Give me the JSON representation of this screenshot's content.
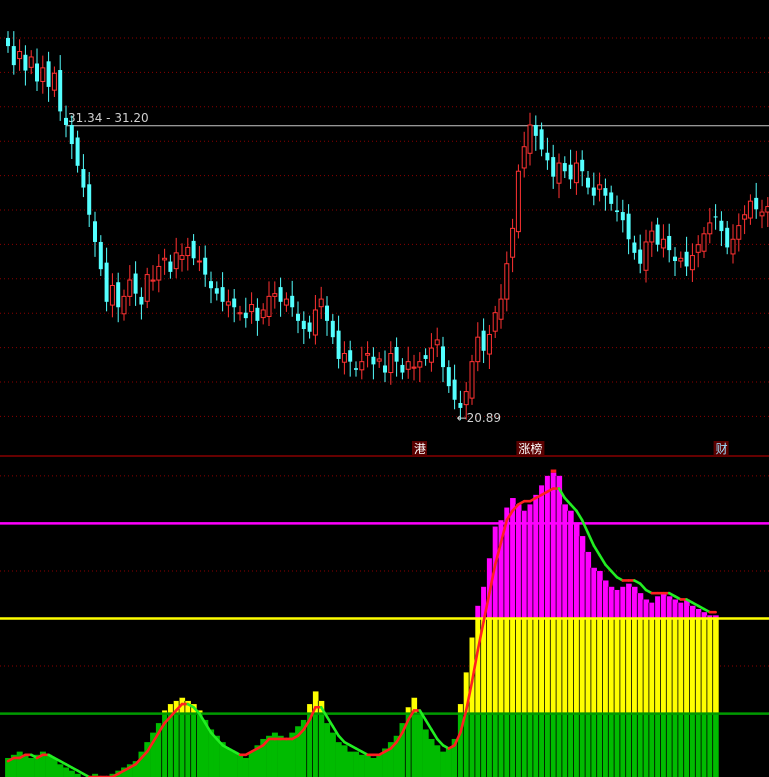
{
  "chart_data": [
    {
      "type": "candlestick",
      "title": "",
      "ylim": [
        19.5,
        35.6
      ],
      "grid": true,
      "reference_line": {
        "label": "31.34 - 31.20",
        "value": 31.27
      },
      "low_marker": {
        "label": "←20.89",
        "index": 77,
        "value": 20.89
      },
      "event_labels": [
        {
          "text": "港",
          "index": 70
        },
        {
          "text": "涨榜",
          "index": 88
        },
        {
          "text": "财",
          "index": 122
        }
      ],
      "colors": {
        "up": "#ff3232",
        "down": "#54ffff",
        "grid": "#8b0000",
        "refline": "#c8c8c8"
      },
      "closes": [
        34.2,
        33.5,
        34.0,
        33.3,
        33.8,
        32.9,
        33.4,
        32.7,
        33.2,
        31.8,
        31.3,
        30.6,
        29.8,
        29.0,
        28.0,
        27.0,
        26.0,
        24.8,
        25.4,
        24.6,
        25.0,
        25.6,
        25.1,
        24.7,
        25.8,
        25.6,
        26.1,
        26.4,
        25.9,
        26.6,
        26.5,
        26.8,
        26.4,
        26.3,
        25.8,
        25.3,
        25.1,
        24.8,
        24.8,
        24.6,
        24.4,
        24.2,
        24.7,
        24.1,
        24.5,
        25.0,
        25.1,
        24.8,
        24.9,
        24.6,
        24.1,
        23.8,
        23.7,
        24.5,
        24.9,
        24.1,
        23.5,
        22.7,
        22.9,
        22.6,
        22.3,
        22.6,
        22.9,
        22.5,
        22.7,
        22.2,
        22.9,
        22.6,
        22.2,
        22.6,
        22.4,
        22.6,
        22.7,
        23.1,
        23.4,
        22.4,
        21.7,
        21.2,
        20.9,
        21.5,
        22.6,
        23.5,
        23.0,
        23.6,
        24.4,
        24.9,
        26.2,
        27.5,
        29.6,
        30.5,
        31.3,
        30.9,
        30.4,
        30.0,
        29.4,
        29.9,
        29.6,
        29.3,
        29.9,
        29.6,
        29.0,
        28.7,
        29.1,
        28.7,
        28.4,
        28.1,
        27.8,
        27.1,
        26.6,
        26.2,
        27.0,
        27.4,
        26.9,
        27.1,
        26.7,
        26.3,
        26.4,
        26.1,
        26.5,
        26.9,
        27.3,
        27.7,
        27.9,
        27.4,
        26.8,
        27.1,
        27.6,
        28.0,
        28.5,
        28.2,
        28.1,
        28.3
      ]
    },
    {
      "type": "bar",
      "title": "",
      "ylim": [
        0,
        100
      ],
      "thresholds": [
        {
          "value": 20,
          "color": "#00bb00"
        },
        {
          "value": 50,
          "color": "#ffff00"
        },
        {
          "value": 80,
          "color": "#ff00ff"
        }
      ],
      "series": [
        {
          "values": [
            6,
            7,
            8,
            7,
            6,
            7,
            8,
            7,
            6,
            4,
            3,
            2,
            1,
            0,
            0,
            1,
            0,
            0,
            1,
            2,
            3,
            4,
            5,
            8,
            11,
            14,
            17,
            21,
            23,
            24,
            25,
            24,
            23,
            21,
            18,
            15,
            13,
            11,
            9,
            8,
            7,
            6,
            8,
            10,
            12,
            13,
            14,
            13,
            12,
            14,
            16,
            18,
            23,
            27,
            24,
            17,
            14,
            11,
            10,
            8,
            8,
            7,
            7,
            6,
            7,
            9,
            11,
            13,
            17,
            22,
            25,
            20,
            15,
            12,
            10,
            8,
            9,
            12,
            23,
            33,
            44,
            54,
            60,
            69,
            79,
            81,
            85,
            88,
            86,
            84,
            86,
            89,
            92,
            95,
            97,
            95,
            86,
            84,
            80,
            76,
            71,
            66,
            65,
            62,
            60,
            59,
            60,
            61,
            60,
            58,
            56,
            55,
            57,
            58,
            57,
            56,
            55,
            56,
            54,
            53,
            52,
            51,
            51
          ]
        },
        {
          "name": "",
          "values": [
            5,
            6,
            6,
            7,
            7,
            6,
            7,
            7,
            6,
            5,
            4,
            3,
            2,
            1,
            0,
            0,
            0,
            0,
            0,
            1,
            2,
            3,
            4,
            6,
            8,
            11,
            14,
            17,
            19,
            21,
            23,
            23,
            22,
            20,
            17,
            14,
            12,
            10,
            9,
            8,
            7,
            7,
            8,
            9,
            10,
            12,
            12,
            12,
            12,
            12,
            13,
            15,
            18,
            22,
            22,
            19,
            16,
            13,
            11,
            10,
            9,
            8,
            7,
            7,
            7,
            8,
            9,
            11,
            14,
            18,
            21,
            21,
            18,
            15,
            12,
            10,
            9,
            10,
            14,
            21,
            30,
            40,
            49,
            58,
            67,
            74,
            81,
            84,
            86,
            87,
            87,
            88,
            89,
            90,
            91,
            91,
            88,
            86,
            84,
            81,
            77,
            73,
            70,
            67,
            65,
            63,
            62,
            62,
            62,
            61,
            59,
            58,
            58,
            58,
            58,
            57,
            56,
            56,
            55,
            54,
            53,
            52,
            52
          ],
          "colors": {
            "rising": "#ff2020",
            "falling": "#22ee22"
          }
        }
      ]
    }
  ]
}
